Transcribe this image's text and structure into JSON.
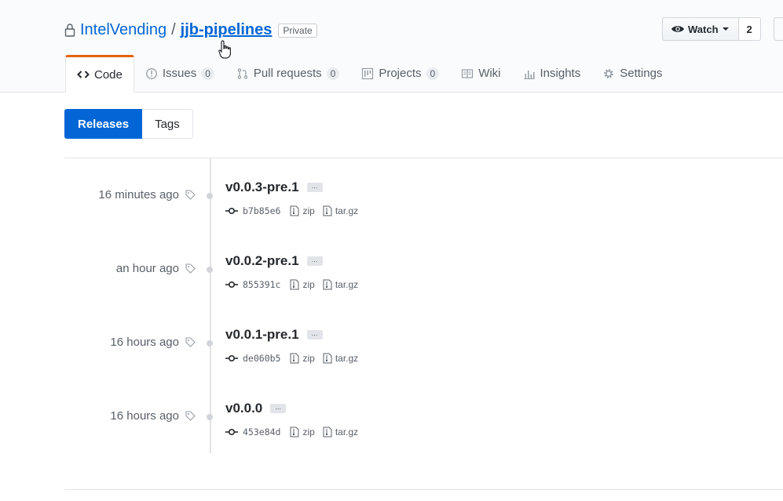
{
  "repo": {
    "owner": "IntelVending",
    "separator": "/",
    "name": "jjb-pipelines",
    "visibility": "Private"
  },
  "watch": {
    "label": "Watch",
    "count": "2"
  },
  "tabs": [
    {
      "label": "Code",
      "icon": "code-icon",
      "selected": true
    },
    {
      "label": "Issues",
      "icon": "issue-icon",
      "count": "0"
    },
    {
      "label": "Pull requests",
      "icon": "pull-request-icon",
      "count": "0"
    },
    {
      "label": "Projects",
      "icon": "project-icon",
      "count": "0"
    },
    {
      "label": "Wiki",
      "icon": "book-icon"
    },
    {
      "label": "Insights",
      "icon": "graph-icon"
    },
    {
      "label": "Settings",
      "icon": "gear-icon"
    }
  ],
  "subnav": {
    "releases": "Releases",
    "tags": "Tags"
  },
  "downloads": {
    "zip": "zip",
    "targz": "tar.gz"
  },
  "more_label": "...",
  "releases": [
    {
      "date": "16 minutes ago",
      "name": "v0.0.3-pre.1",
      "sha": "b7b85e6"
    },
    {
      "date": "an hour ago",
      "name": "v0.0.2-pre.1",
      "sha": "855391c"
    },
    {
      "date": "16 hours ago",
      "name": "v0.0.1-pre.1",
      "sha": "de060b5"
    },
    {
      "date": "16 hours ago",
      "name": "v0.0.0",
      "sha": "453e84d"
    }
  ],
  "colors": {
    "link": "#0366d6",
    "selected_tab_accent": "#e36209",
    "primary_button": "#0366d6"
  }
}
